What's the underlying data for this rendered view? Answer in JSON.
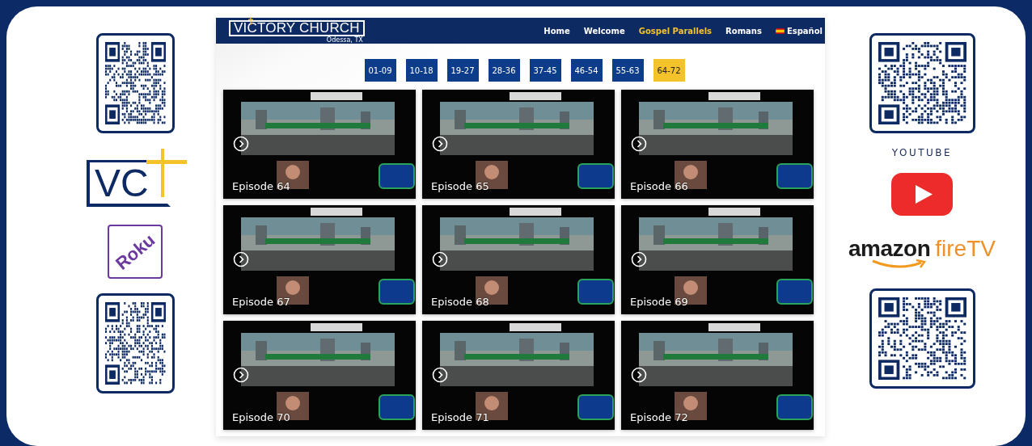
{
  "left_column": {
    "logo": {
      "letters": "VC"
    },
    "roku": {
      "label": "Roku"
    }
  },
  "right_column": {
    "youtube_label": "YOUTUBE",
    "amazon": {
      "brand": "amazon",
      "product": "fireTV"
    }
  },
  "site": {
    "logo": {
      "name": "VICTORY CHURCH",
      "place": "Odessa, TX"
    },
    "nav": [
      {
        "label": "Home",
        "selected": false
      },
      {
        "label": "Welcome",
        "selected": false
      },
      {
        "label": "Gospel Parallels",
        "selected": true
      },
      {
        "label": "Romans",
        "selected": false
      },
      {
        "label": "Español",
        "selected": false,
        "flag": true
      }
    ]
  },
  "episode_ranges": [
    {
      "label": "01-09",
      "selected": false
    },
    {
      "label": "10-18",
      "selected": false
    },
    {
      "label": "19-27",
      "selected": false
    },
    {
      "label": "28-36",
      "selected": false
    },
    {
      "label": "37-45",
      "selected": false
    },
    {
      "label": "46-54",
      "selected": false
    },
    {
      "label": "55-63",
      "selected": false
    },
    {
      "label": "64-72",
      "selected": true
    }
  ],
  "episodes": [
    {
      "caption": "Episode 64"
    },
    {
      "caption": "Episode 65"
    },
    {
      "caption": "Episode 66"
    },
    {
      "caption": "Episode 67"
    },
    {
      "caption": "Episode 68"
    },
    {
      "caption": "Episode 69"
    },
    {
      "caption": "Episode 70"
    },
    {
      "caption": "Episode 71"
    },
    {
      "caption": "Episode 72"
    }
  ]
}
